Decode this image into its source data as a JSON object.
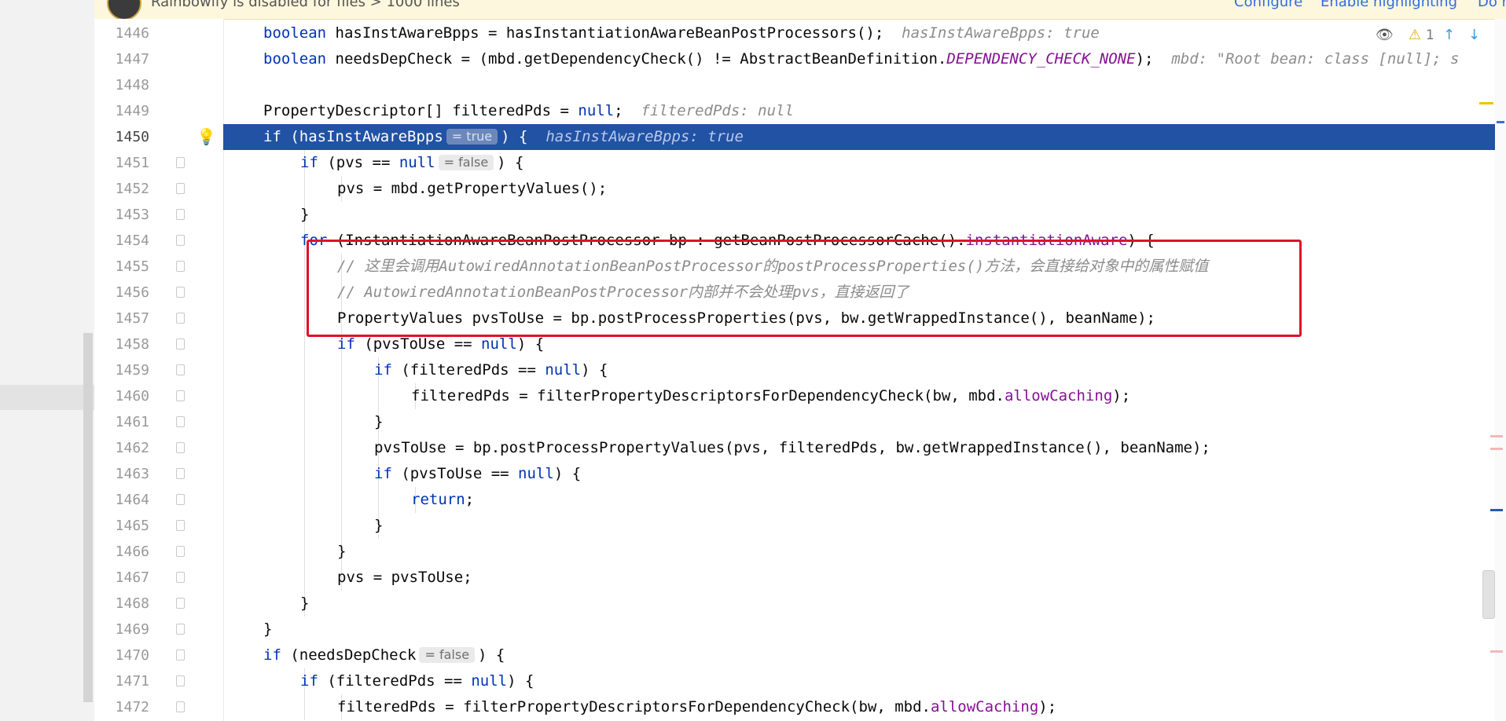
{
  "banner": {
    "message": "Rainbowify is disabled for files > 1000 lines",
    "links": [
      "Configure",
      "Enable highlighting",
      "Do not ask again"
    ]
  },
  "inspections": {
    "warning_count": "1"
  },
  "lines": [
    {
      "n": "1446",
      "indent": 1,
      "segs": [
        {
          "t": "boolean",
          "c": "kw"
        },
        {
          "t": " hasInstAwareBpps = hasInstantiationAwareBeanPostProcessors();  "
        },
        {
          "t": "hasInstAwareBpps: true",
          "c": "hint"
        }
      ]
    },
    {
      "n": "1447",
      "indent": 1,
      "segs": [
        {
          "t": "boolean",
          "c": "kw"
        },
        {
          "t": " needsDepCheck = (mbd.getDependencyCheck() != AbstractBeanDefinition."
        },
        {
          "t": "DEPENDENCY_CHECK_NONE",
          "c": "const"
        },
        {
          "t": ");  "
        },
        {
          "t": "mbd: \"Root bean: class [null]; s",
          "c": "hint"
        }
      ]
    },
    {
      "n": "1448",
      "indent": 1,
      "segs": []
    },
    {
      "n": "1449",
      "indent": 1,
      "segs": [
        {
          "t": "PropertyDescriptor[] filteredPds = "
        },
        {
          "t": "null",
          "c": "kw"
        },
        {
          "t": ";  "
        },
        {
          "t": "filteredPds: null",
          "c": "hint"
        }
      ]
    },
    {
      "n": "1450",
      "indent": 1,
      "hl": true,
      "segs": [
        {
          "t": "if",
          "c": "kw"
        },
        {
          "t": " (hasInstAwareBpps"
        },
        {
          "t": "= true",
          "c": "chip"
        },
        {
          "t": ") {  "
        },
        {
          "t": "hasInstAwareBpps: true",
          "c": "hint"
        }
      ]
    },
    {
      "n": "1451",
      "indent": 2,
      "segs": [
        {
          "t": "if",
          "c": "kw"
        },
        {
          "t": " (pvs == "
        },
        {
          "t": "null",
          "c": "kw"
        },
        {
          "t": "= false",
          "c": "chip"
        },
        {
          "t": ") {"
        }
      ]
    },
    {
      "n": "1452",
      "indent": 3,
      "segs": [
        {
          "t": "pvs = mbd.getPropertyValues();"
        }
      ]
    },
    {
      "n": "1453",
      "indent": 2,
      "segs": [
        {
          "t": "}"
        }
      ]
    },
    {
      "n": "1454",
      "indent": 2,
      "segs": [
        {
          "t": "for",
          "c": "kw"
        },
        {
          "t": " (InstantiationAwareBeanPostProcessor bp : getBeanPostProcessorCache()."
        },
        {
          "t": "instantiationAware",
          "c": "field"
        },
        {
          "t": ") {"
        }
      ]
    },
    {
      "n": "1455",
      "indent": 3,
      "segs": [
        {
          "t": "// 这里会调用AutowiredAnnotationBeanPostProcessor的postProcessProperties()方法，会直接给对象中的属性赋值",
          "c": "cmt"
        }
      ]
    },
    {
      "n": "1456",
      "indent": 3,
      "segs": [
        {
          "t": "// AutowiredAnnotationBeanPostProcessor内部并不会处理pvs，直接返回了",
          "c": "cmt"
        }
      ]
    },
    {
      "n": "1457",
      "indent": 3,
      "segs": [
        {
          "t": "PropertyValues pvsToUse = bp.postProcessProperties(pvs, bw.getWrappedInstance(), beanName);"
        }
      ]
    },
    {
      "n": "1458",
      "indent": 3,
      "segs": [
        {
          "t": "if",
          "c": "kw"
        },
        {
          "t": " (pvsToUse == "
        },
        {
          "t": "null",
          "c": "kw"
        },
        {
          "t": ") {"
        }
      ]
    },
    {
      "n": "1459",
      "indent": 4,
      "segs": [
        {
          "t": "if",
          "c": "kw"
        },
        {
          "t": " (filteredPds == "
        },
        {
          "t": "null",
          "c": "kw"
        },
        {
          "t": ") {"
        }
      ]
    },
    {
      "n": "1460",
      "indent": 5,
      "segs": [
        {
          "t": "filteredPds = filterPropertyDescriptorsForDependencyCheck(bw, mbd."
        },
        {
          "t": "allowCaching",
          "c": "field"
        },
        {
          "t": ");"
        }
      ]
    },
    {
      "n": "1461",
      "indent": 4,
      "segs": [
        {
          "t": "}"
        }
      ]
    },
    {
      "n": "1462",
      "indent": 4,
      "segs": [
        {
          "t": "pvsToUse = bp.postProcessPropertyValues(pvs, filteredPds, bw.getWrappedInstance(), beanName);"
        }
      ]
    },
    {
      "n": "1463",
      "indent": 4,
      "segs": [
        {
          "t": "if",
          "c": "kw"
        },
        {
          "t": " (pvsToUse == "
        },
        {
          "t": "null",
          "c": "kw"
        },
        {
          "t": ") {"
        }
      ]
    },
    {
      "n": "1464",
      "indent": 5,
      "segs": [
        {
          "t": "return",
          "c": "kw"
        },
        {
          "t": ";"
        }
      ]
    },
    {
      "n": "1465",
      "indent": 4,
      "segs": [
        {
          "t": "}"
        }
      ]
    },
    {
      "n": "1466",
      "indent": 3,
      "segs": [
        {
          "t": "}"
        }
      ]
    },
    {
      "n": "1467",
      "indent": 3,
      "segs": [
        {
          "t": "pvs = pvsToUse;"
        }
      ]
    },
    {
      "n": "1468",
      "indent": 2,
      "segs": [
        {
          "t": "}"
        }
      ]
    },
    {
      "n": "1469",
      "indent": 1,
      "segs": [
        {
          "t": "}"
        }
      ]
    },
    {
      "n": "1470",
      "indent": 1,
      "segs": [
        {
          "t": "if",
          "c": "kw"
        },
        {
          "t": " (needsDepCheck"
        },
        {
          "t": "= false",
          "c": "chip"
        },
        {
          "t": ") {"
        }
      ]
    },
    {
      "n": "1471",
      "indent": 2,
      "segs": [
        {
          "t": "if",
          "c": "kw"
        },
        {
          "t": " (filteredPds == "
        },
        {
          "t": "null",
          "c": "kw"
        },
        {
          "t": ") {"
        }
      ]
    },
    {
      "n": "1472",
      "indent": 3,
      "segs": [
        {
          "t": "filteredPds = filterPropertyDescriptorsForDependencyCheck(bw, mbd."
        },
        {
          "t": "allowCaching",
          "c": "field"
        },
        {
          "t": ");"
        }
      ]
    }
  ]
}
